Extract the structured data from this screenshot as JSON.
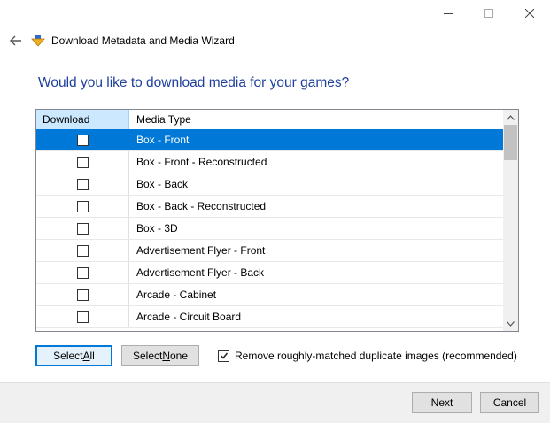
{
  "wizard": {
    "title": "Download Metadata and Media Wizard",
    "heading": "Would you like to download media for your games?"
  },
  "grid": {
    "columns": [
      "Download",
      "Media Type"
    ],
    "rows": [
      {
        "label": "Box - Front",
        "checked": false,
        "selected": true
      },
      {
        "label": "Box - Front - Reconstructed",
        "checked": false,
        "selected": false
      },
      {
        "label": "Box - Back",
        "checked": false,
        "selected": false
      },
      {
        "label": "Box - Back - Reconstructed",
        "checked": false,
        "selected": false
      },
      {
        "label": "Box - 3D",
        "checked": false,
        "selected": false
      },
      {
        "label": "Advertisement Flyer - Front",
        "checked": false,
        "selected": false
      },
      {
        "label": "Advertisement Flyer - Back",
        "checked": false,
        "selected": false
      },
      {
        "label": "Arcade - Cabinet",
        "checked": false,
        "selected": false
      },
      {
        "label": "Arcade - Circuit Board",
        "checked": false,
        "selected": false
      }
    ]
  },
  "buttons": {
    "select_all_prefix": "Select ",
    "select_all_accel": "A",
    "select_all_suffix": "ll",
    "select_none_prefix": "Select ",
    "select_none_accel": "N",
    "select_none_suffix": "one",
    "next": "Next",
    "cancel": "Cancel"
  },
  "options": {
    "remove_duplicates_label": "Remove roughly-matched duplicate images (recommended)",
    "remove_duplicates_checked": true
  },
  "icons": {
    "back": "back-arrow-icon",
    "wizard": "download-arrow-icon",
    "minimize": "minimize-icon",
    "maximize": "maximize-icon",
    "close": "close-icon"
  },
  "colors": {
    "accent": "#0078d7",
    "heading": "#1e3f9c",
    "header_highlight": "#cce8ff"
  }
}
